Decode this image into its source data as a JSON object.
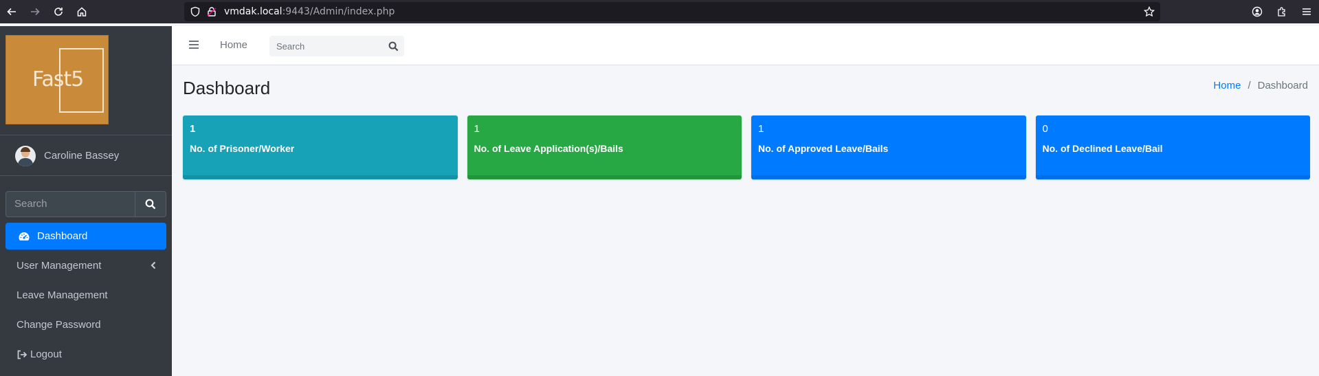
{
  "browser": {
    "url_host": "vmdak.local",
    "url_rest": ":9443/Admin/index.php"
  },
  "sidebar": {
    "brand_text": "Fast5",
    "user_name": "Caroline Bassey",
    "search_placeholder": "Search",
    "items": [
      {
        "label": "Dashboard",
        "icon": "tachometer-icon",
        "active": true
      },
      {
        "label": "User Management",
        "icon": "",
        "has_submenu": true
      },
      {
        "label": "Leave Management",
        "icon": ""
      },
      {
        "label": "Change Password",
        "icon": ""
      },
      {
        "label": "Logout",
        "icon": "sign-out-icon"
      }
    ]
  },
  "header": {
    "home_label": "Home",
    "search_placeholder": "Search"
  },
  "page": {
    "title": "Dashboard",
    "breadcrumb": {
      "home": "Home",
      "current": "Dashboard"
    }
  },
  "stats": [
    {
      "value": "1",
      "label": "No. of Prisoner/Worker",
      "color": "#17a2b8"
    },
    {
      "value": "1",
      "label": "No. of Leave Application(s)/Bails",
      "color": "#28a745"
    },
    {
      "value": "1",
      "label": "No. of Approved Leave/Bails",
      "color": "#007bff"
    },
    {
      "value": "0",
      "label": "No. of Declined Leave/Bail",
      "color": "#007bff"
    }
  ]
}
